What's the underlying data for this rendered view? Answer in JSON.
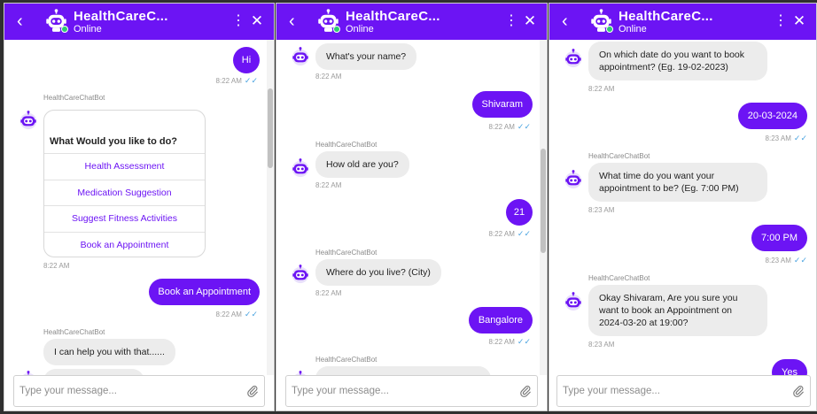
{
  "header": {
    "title": "HealthCareC...",
    "status": "Online",
    "back": "‹",
    "menu": "⋮",
    "close": "✕"
  },
  "composer": {
    "placeholder": "Type your message..."
  },
  "bot_name": "HealthCareChatBot",
  "icons": {
    "avatar": "robot-icon",
    "attach": "paperclip-icon",
    "read": "double-check-icon"
  },
  "colors": {
    "brand": "#6c14f4",
    "bot_bubble": "#ececec",
    "online": "#2ecc71",
    "read_tick": "#4aa3e0"
  },
  "panel1": {
    "msg_hi": "Hi",
    "time_hi": "8:22 AM",
    "menu_title": "What Would you like to do?",
    "options": [
      "Health Assessment",
      "Medication Suggestion",
      "Suggest Fitness Activities",
      "Book an Appointment"
    ],
    "time_menu": "8:22 AM",
    "msg_book": "Book an Appointment",
    "time_book": "8:22 AM",
    "msg_help": "I can help you with that......",
    "msg_name": "What's your name?"
  },
  "panel2": {
    "msg_name": "What's your name?",
    "time_name": "8:22 AM",
    "msg_shivaram": "Shivaram",
    "time_shivaram": "8:22 AM",
    "msg_age": "How old are you?",
    "time_age": "8:22 AM",
    "msg_21": "21",
    "time_21": "8:22 AM",
    "msg_city": "Where do you live? (City)",
    "time_city": "8:22 AM",
    "msg_bangalore": "Bangalore",
    "time_bangalore": "8:22 AM",
    "msg_date": "On which date do you want to book"
  },
  "panel3": {
    "msg_date": "On which date do you want to book appointment? (Eg. 19-02-2023)",
    "time_date": "8:22 AM",
    "msg_date_ans": "20-03-2024",
    "time_date_ans": "8:23 AM",
    "msg_time": "What time do you want your appointment to be? (Eg. 7:00 PM)",
    "time_time": "8:23 AM",
    "msg_time_ans": "7:00 PM",
    "time_time_ans": "8:23 AM",
    "msg_confirm": "Okay Shivaram, Are you sure you want to book an Appointment on 2024-03-20 at 19:00?",
    "time_confirm": "8:23 AM",
    "msg_yes": "Yes"
  }
}
